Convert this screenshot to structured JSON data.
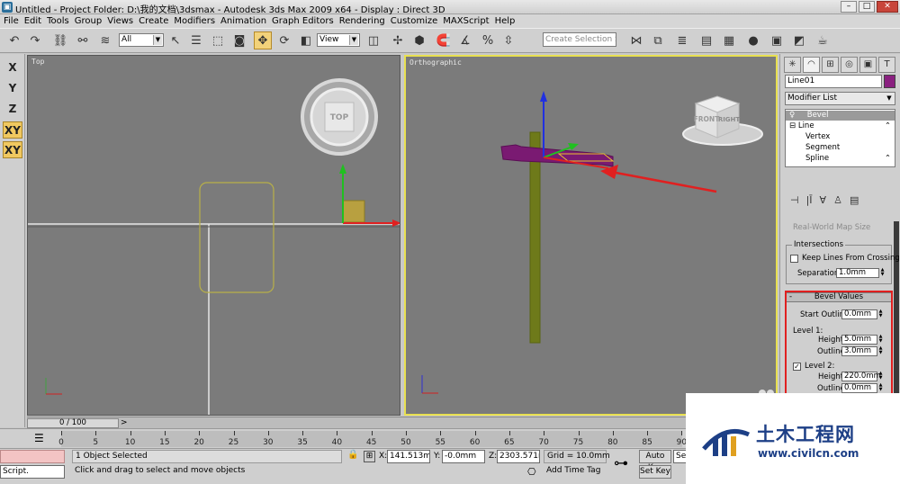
{
  "window": {
    "title": "Untitled    - Project Folder: D:\\我的文档\\3dsmax    - Autodesk 3ds Max  2009 x64     - Display : Direct 3D"
  },
  "menu": [
    "File",
    "Edit",
    "Tools",
    "Group",
    "Views",
    "Create",
    "Modifiers",
    "Animation",
    "Graph Editors",
    "Rendering",
    "Customize",
    "MAXScript",
    "Help"
  ],
  "toolbar": {
    "selection_filter": "All",
    "reference_coord": "View",
    "named_selection_placeholder": "Create Selection Set"
  },
  "axis_constraints": [
    "X",
    "Y",
    "Z",
    "XY",
    "XY"
  ],
  "viewports": {
    "top": {
      "label": "Top",
      "viewcube_face": "TOP"
    },
    "ortho": {
      "label": "Orthographic",
      "viewcube_face_1": "FRONT",
      "viewcube_face_2": "RIGHT"
    }
  },
  "command_panel": {
    "object_name": "Line01",
    "object_color": "#8a2080",
    "modifier_list": "Modifier List",
    "stack": [
      {
        "label": "Bevel",
        "level": 0,
        "selected": true
      },
      {
        "label": "Line",
        "level": 0,
        "selected": false
      },
      {
        "label": "Vertex",
        "level": 1,
        "selected": false
      },
      {
        "label": "Segment",
        "level": 1,
        "selected": false
      },
      {
        "label": "Spline",
        "level": 1,
        "selected": false
      }
    ],
    "real_world_map_size": "Real-World Map Size",
    "intersections": {
      "title": "Intersections",
      "keep_lines_label": "Keep Lines From Crossing",
      "keep_lines_checked": false,
      "separation_label": "Separation:",
      "separation_value": "1.0mm"
    },
    "bevel_values": {
      "title": "Bevel Values",
      "start_outline_label": "Start Outline:",
      "start_outline_value": "0.0mm",
      "level1_label": "Level 1:",
      "level1_height_label": "Height:",
      "level1_height_value": "5.0mm",
      "level1_outline_label": "Outline:",
      "level1_outline_value": "3.0mm",
      "level2_label": "Level 2:",
      "level2_checked": true,
      "level2_height_label": "Height:",
      "level2_height_value": "220.0mm",
      "level2_outline_label": "Outline:",
      "level2_outline_value": "0.0mm"
    }
  },
  "timeline": {
    "slider_label": "0 / 100",
    "ticks": [
      "0",
      "5",
      "10",
      "15",
      "20",
      "25",
      "30",
      "35",
      "40",
      "45",
      "50",
      "55",
      "60",
      "65",
      "70",
      "75",
      "80",
      "85",
      "90"
    ]
  },
  "status": {
    "maxscript_label": "Script.",
    "selection_info": "1 Object Selected",
    "prompt": "Click and drag to select and move objects",
    "x_label": "X:",
    "x_value": "141.513mm",
    "y_label": "Y:",
    "y_value": "-0.0mm",
    "z_label": "Z:",
    "z_value": "2303.571m",
    "grid": "Grid = 10.0mm",
    "add_time_tag": "Add Time Tag",
    "auto_key": "Auto Key",
    "set_key": "Set Key",
    "selected_dropdown": "Sel"
  },
  "watermark": {
    "text_cn": "土木工程网",
    "url": "www.civilcn.com"
  },
  "colors": {
    "active_viewport_border": "#e8e050",
    "highlight_button": "#f0c860",
    "annotation_red": "#e02020",
    "column_green": "#6e7a1a",
    "profile_purple": "#7a1a72"
  }
}
